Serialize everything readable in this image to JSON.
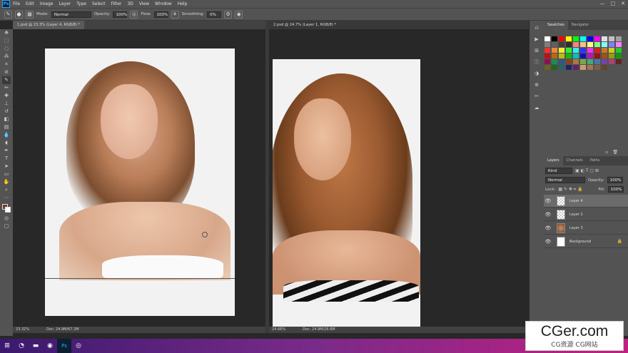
{
  "menu": {
    "logo": "Ps",
    "items": [
      "File",
      "Edit",
      "Image",
      "Layer",
      "Type",
      "Select",
      "Filter",
      "3D",
      "View",
      "Window",
      "Help"
    ],
    "min": "—",
    "max": "□",
    "close": "✕"
  },
  "options": {
    "mode_label": "Mode:",
    "mode_value": "Normal",
    "opacity_label": "Opacity:",
    "opacity_value": "100%",
    "flow_label": "Flow:",
    "flow_value": "100%",
    "smoothing_label": "Smoothing:",
    "smoothing_value": "0%"
  },
  "doc1": {
    "tab": "1.psd @ 23.3% (Layer 4, RGB/8) *",
    "zoom": "23.32%",
    "docsize": "Doc: 24.9M/67.2M"
  },
  "doc2": {
    "tab": "2.psd @ 24.7% (Layer 1, RGB/8) *",
    "zoom": "24.66%",
    "docsize": "Doc: 24.9M/26.6M"
  },
  "swatches": {
    "tabs": [
      "Swatches",
      "Navigator"
    ],
    "colors": [
      "#ffffff",
      "#000000",
      "#ff0000",
      "#ffff00",
      "#00ff00",
      "#00ffff",
      "#0000ff",
      "#ff00ff",
      "#e0e0e0",
      "#c0c0c0",
      "#a0a0a0",
      "#808080",
      "#606060",
      "#404040",
      "#303030",
      "#ff8080",
      "#ffc080",
      "#ffff80",
      "#80ff80",
      "#80ffff",
      "#8080ff",
      "#ff80ff",
      "#ee3333",
      "#ee8833",
      "#eeee33",
      "#33ee33",
      "#33eeee",
      "#3333ee",
      "#ee33ee",
      "#cc2222",
      "#cc7722",
      "#cccc22",
      "#22cc22",
      "#bb1111",
      "#bb6611",
      "#bbbb11",
      "#11bb11",
      "#11bbbb",
      "#1111bb",
      "#bb11bb",
      "#991111",
      "#995511",
      "#999911",
      "#119911",
      "#881155",
      "#228855",
      "#335588",
      "#884422",
      "#aa7744",
      "#77aa44",
      "#44aa77",
      "#4477aa",
      "#7744aa",
      "#aa4477",
      "#662222",
      "#666622",
      "#226622",
      "#226666",
      "#222266",
      "#662266",
      "#c8a070",
      "#a07850",
      "#806040",
      "#604830"
    ]
  },
  "layers": {
    "tabs": [
      "Layers",
      "Channels",
      "Paths"
    ],
    "kind": "Kind",
    "blend": "Normal",
    "opacity_label": "Opacity:",
    "opacity": "100%",
    "lock_label": "Lock:",
    "fill_label": "Fill:",
    "fill": "100%",
    "items": [
      "Layer 4",
      "Layer 2",
      "Layer 3",
      "Background"
    ]
  },
  "watermark": {
    "big": "CGer.com",
    "small": "CG资源 CG网站"
  }
}
